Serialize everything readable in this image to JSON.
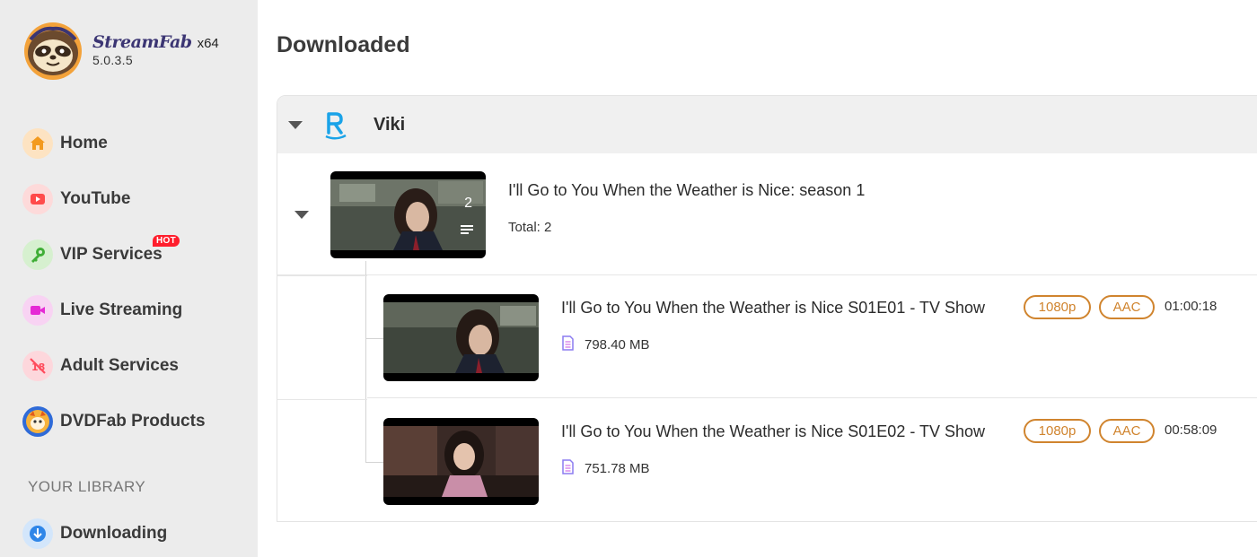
{
  "app": {
    "name": "StreamFab",
    "arch": "x64",
    "version": "5.0.3.5"
  },
  "sidebar": {
    "items": [
      {
        "label": "Home",
        "icon": "home-icon",
        "color": "#f5a623"
      },
      {
        "label": "YouTube",
        "icon": "youtube-icon",
        "color": "#ff4b4b"
      },
      {
        "label": "VIP Services",
        "icon": "key-icon",
        "color": "#4cb944",
        "badge": "HOT"
      },
      {
        "label": "Live Streaming",
        "icon": "video-camera-icon",
        "color": "#e52ad5"
      },
      {
        "label": "Adult Services",
        "icon": "adult-18-icon",
        "color": "#ff4b5c"
      },
      {
        "label": "DVDFab Products",
        "icon": "dvdfab-icon",
        "color": "#2f6bd8"
      }
    ],
    "library_title": "YOUR LIBRARY",
    "library_items": [
      {
        "label": "Downloading",
        "icon": "download-arrow-icon",
        "color": "#2f86e8"
      }
    ]
  },
  "main": {
    "title": "Downloaded",
    "group": {
      "name": "Viki",
      "season": {
        "title": "I'll Go to You When the Weather is Nice: season 1",
        "count": "2",
        "total": "Total: 2"
      },
      "episodes": [
        {
          "title": "I'll Go to You When the Weather is Nice S01E01 - TV Show",
          "resolution": "1080p",
          "audio": "AAC",
          "duration": "01:00:18",
          "size": "798.40 MB"
        },
        {
          "title": "I'll Go to You When the Weather is Nice S01E02 - TV Show",
          "resolution": "1080p",
          "audio": "AAC",
          "duration": "00:58:09",
          "size": "751.78 MB"
        }
      ]
    }
  },
  "colors": {
    "accent_tag": "#d0842e",
    "viki_blue": "#1aa3e8",
    "sidebar_bg": "#ececec"
  }
}
